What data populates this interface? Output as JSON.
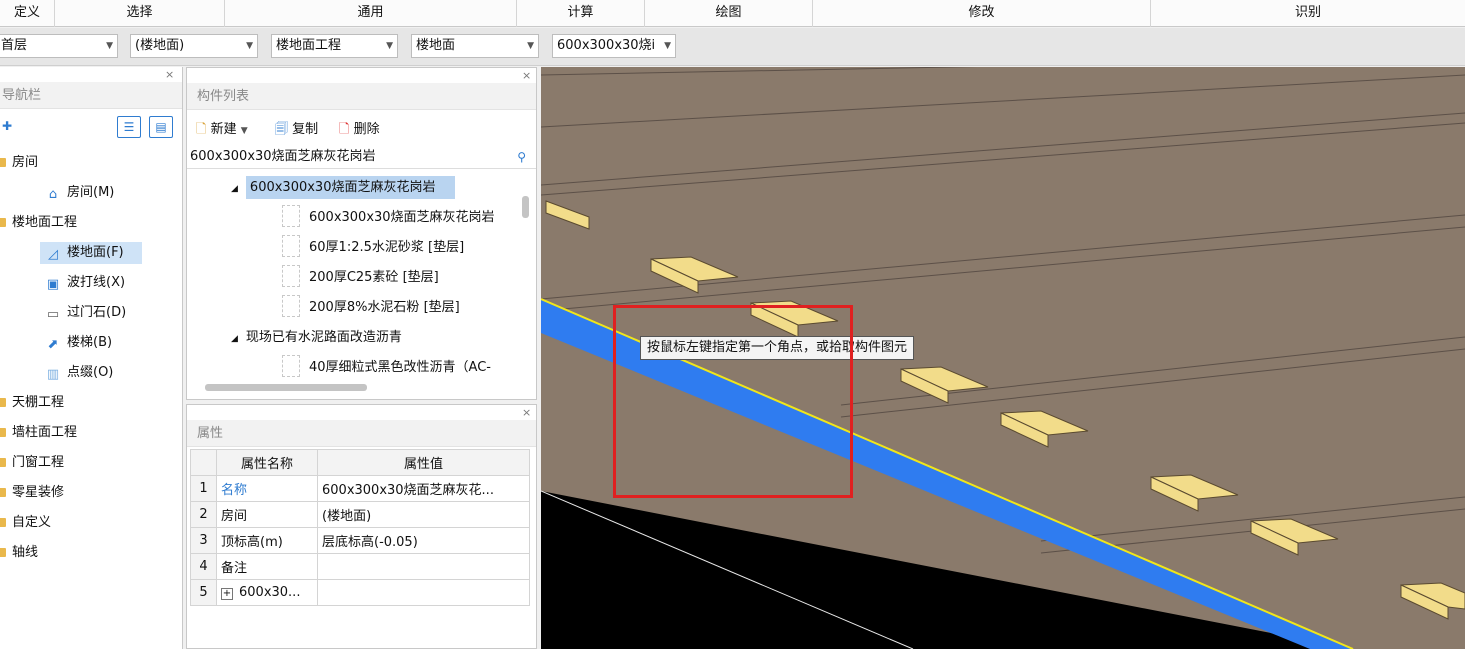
{
  "ribbon": {
    "groups": [
      "定义",
      "选择",
      "通用",
      "计算",
      "绘图",
      "修改",
      "识别"
    ]
  },
  "toolbar": {
    "floor": "首层",
    "room": "(楼地面)",
    "category": "楼地面工程",
    "type": "楼地面",
    "component": "600x300x30烧i"
  },
  "nav": {
    "title": "导航栏",
    "close": "×",
    "items": [
      {
        "label": "房间",
        "level": 0
      },
      {
        "label": "房间(M)",
        "level": 1,
        "icon": "house-icon"
      },
      {
        "label": "楼地面工程",
        "level": 0
      },
      {
        "label": "楼地面(F)",
        "level": 1,
        "icon": "floor-icon",
        "selected": true
      },
      {
        "label": "波打线(X)",
        "level": 1,
        "icon": "border-icon"
      },
      {
        "label": "过门石(D)",
        "level": 1,
        "icon": "threshold-icon"
      },
      {
        "label": "楼梯(B)",
        "level": 1,
        "icon": "stairs-icon"
      },
      {
        "label": "点缀(O)",
        "level": 1,
        "icon": "dot-icon"
      },
      {
        "label": "天棚工程",
        "level": 0
      },
      {
        "label": "墙柱面工程",
        "level": 0
      },
      {
        "label": "门窗工程",
        "level": 0
      },
      {
        "label": "零星装修",
        "level": 0
      },
      {
        "label": "自定义",
        "level": 0
      },
      {
        "label": "轴线",
        "level": 0
      }
    ]
  },
  "components": {
    "title": "构件列表",
    "close": "×",
    "new_label": "新建",
    "copy_label": "复制",
    "delete_label": "删除",
    "search_value": "600x300x30烧面芝麻灰花岗岩",
    "tree": [
      {
        "label": "600x300x30烧面芝麻灰花岗岩",
        "level": 0,
        "selected": true
      },
      {
        "label": "600x300x30烧面芝麻灰花岗岩",
        "level": 1
      },
      {
        "label": "60厚1:2.5水泥砂浆 [垫层]",
        "level": 1
      },
      {
        "label": "200厚C25素砼 [垫层]",
        "level": 1
      },
      {
        "label": "200厚8%水泥石粉 [垫层]",
        "level": 1
      },
      {
        "label": "现场已有水泥路面改造沥青",
        "level": 0
      },
      {
        "label": "40厚细粒式黑色改性沥青（AC-",
        "level": 1
      }
    ]
  },
  "properties": {
    "title": "属性",
    "close": "×",
    "col_name": "属性名称",
    "col_value": "属性值",
    "rows": [
      {
        "num": "1",
        "name": "名称",
        "value": "600x300x30烧面芝麻灰花..."
      },
      {
        "num": "2",
        "name": "房间",
        "value": "(楼地面)"
      },
      {
        "num": "3",
        "name": "顶标高(m)",
        "value": "层底标高(-0.05)"
      },
      {
        "num": "4",
        "name": "备注",
        "value": ""
      },
      {
        "num": "5",
        "name": "600x30...",
        "value": ""
      }
    ]
  },
  "canvas": {
    "tooltip": "按鼠标左键指定第一个角点，或拾取构件图元"
  },
  "colors": {
    "ground": "#8a7a6b",
    "blue_band": "#2f7cf0",
    "edge_line": "#f0e61a",
    "void": "#000000",
    "blocks": "#f2dc8a",
    "selection": "#e02020"
  }
}
